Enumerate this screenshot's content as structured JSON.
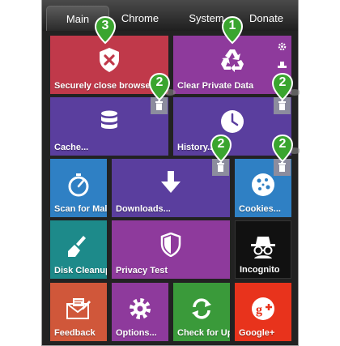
{
  "tabs": [
    {
      "label": "Main",
      "active": true
    },
    {
      "label": "Chrome",
      "active": false
    },
    {
      "label": "System",
      "active": false
    },
    {
      "label": "Donate",
      "active": false
    }
  ],
  "tiles": {
    "close_browser": {
      "label": "Securely close browser",
      "color": "#c0394a",
      "icon": "shield-x-icon"
    },
    "clear_private": {
      "label": "Clear Private Data",
      "color": "#8e3a9c",
      "icon": "recycle-icon"
    },
    "cache": {
      "label": "Cache...",
      "color": "#5a3e9e",
      "icon": "database-icon"
    },
    "history": {
      "label": "History...",
      "color": "#5a3e9e",
      "icon": "clock-icon"
    },
    "scan": {
      "label": "Scan for Malware",
      "color": "#2f80c4",
      "icon": "stopwatch-icon"
    },
    "downloads": {
      "label": "Downloads...",
      "color": "#5a3e9e",
      "icon": "download-arrow-icon"
    },
    "cookies": {
      "label": "Cookies...",
      "color": "#2f80c4",
      "icon": "cookie-icon"
    },
    "disk_cleanup": {
      "label": "Disk Cleanup",
      "color": "#1d8a8a",
      "icon": "broom-icon"
    },
    "privacy_test": {
      "label": "Privacy Test",
      "color": "#8e3a9c",
      "icon": "shield-icon"
    },
    "incognito": {
      "label": "Incognito",
      "color": "#111111",
      "icon": "spy-icon"
    },
    "feedback": {
      "label": "Feedback",
      "color": "#d0573a",
      "icon": "envelope-pencil-icon"
    },
    "options": {
      "label": "Options...",
      "color": "#8e3a9c",
      "icon": "gear-icon"
    },
    "check_updates": {
      "label": "Check for Updates",
      "color": "#3a9a3a",
      "icon": "refresh-icon"
    },
    "google_plus": {
      "label": "Google+",
      "color": "#e8331c",
      "icon": "google-plus-icon"
    }
  },
  "badges": {
    "one": "1",
    "two": "2",
    "three": "3",
    "color": "#3aa52f"
  }
}
